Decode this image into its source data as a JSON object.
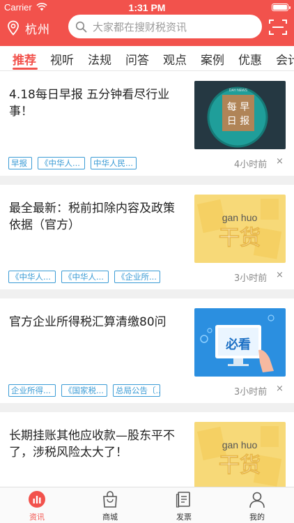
{
  "status_bar": {
    "carrier": "Carrier",
    "time": "1:31 PM"
  },
  "header": {
    "city": "杭州",
    "search_placeholder": "大家都在搜财税资讯"
  },
  "tabs": [
    {
      "label": "推荐",
      "active": true
    },
    {
      "label": "视听"
    },
    {
      "label": "法规"
    },
    {
      "label": "问答"
    },
    {
      "label": "观点"
    },
    {
      "label": "案例"
    },
    {
      "label": "优惠"
    },
    {
      "label": "会计"
    }
  ],
  "articles": [
    {
      "title": "4.18每日早报 五分钟看尽行业事！",
      "tags": [
        "早报",
        "《中华人...",
        "中华人民..."
      ],
      "time": "4小时前",
      "thumb": {
        "kind": "daily",
        "top": "DAY NEWS",
        "line1": "每 早",
        "line2": "日 报"
      }
    },
    {
      "title": "最全最新：税前扣除内容及政策依据（官方）",
      "tags": [
        "《中华人...",
        "《中华人...",
        "《企业所..."
      ],
      "time": "3小时前",
      "thumb": {
        "kind": "ganhuo",
        "pinyin": "gan huo",
        "text": "干货"
      }
    },
    {
      "title": "官方企业所得税汇算清缴80问",
      "tags": [
        "企业所得...",
        "《国家税...",
        "总局公告〔..."
      ],
      "time": "3小时前",
      "thumb": {
        "kind": "bikan",
        "text": "必看"
      }
    },
    {
      "title": "长期挂账其他应收款—股东平不了，涉税风险太大了！",
      "tags": [],
      "time": "",
      "thumb": {
        "kind": "ganhuo",
        "pinyin": "gan huo",
        "text": "干货"
      }
    }
  ],
  "close_symbol": "×",
  "bottom_nav": [
    {
      "label": "资讯",
      "icon": "news-chart-icon",
      "active": true
    },
    {
      "label": "商城",
      "icon": "shopping-bag-icon"
    },
    {
      "label": "发票",
      "icon": "invoice-icon"
    },
    {
      "label": "我的",
      "icon": "person-icon"
    }
  ],
  "colors": {
    "brand": "#f2524c",
    "tag": "#3a9bd5"
  }
}
